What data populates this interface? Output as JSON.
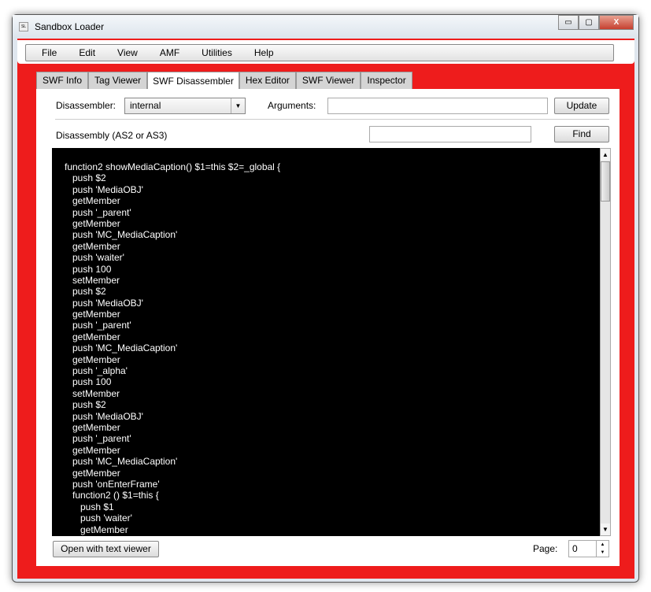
{
  "window": {
    "title": "Sandbox Loader",
    "minimize": "▭",
    "maximize": "▢",
    "close": "X",
    "icon_text": "SL"
  },
  "menu": [
    "File",
    "Edit",
    "View",
    "AMF",
    "Utilities",
    "Help"
  ],
  "tabs": [
    {
      "label": "SWF Info"
    },
    {
      "label": "Tag Viewer"
    },
    {
      "label": "SWF Disassembler",
      "active": true
    },
    {
      "label": "Hex Editor"
    },
    {
      "label": "SWF Viewer"
    },
    {
      "label": "Inspector"
    }
  ],
  "toolbar": {
    "disassembler_label": "Disassembler:",
    "disassembler_value": "internal",
    "arguments_label": "Arguments:",
    "arguments_value": "",
    "update": "Update",
    "disassembly_label": "Disassembly (AS2 or AS3)",
    "find_value": "",
    "find": "Find"
  },
  "code": [
    "function2 showMediaCaption() $1=this $2=_global {",
    "   push $2",
    "   push 'MediaOBJ'",
    "   getMember",
    "   push '_parent'",
    "   getMember",
    "   push 'MC_MediaCaption'",
    "   getMember",
    "   push 'waiter'",
    "   push 100",
    "   setMember",
    "   push $2",
    "   push 'MediaOBJ'",
    "   getMember",
    "   push '_parent'",
    "   getMember",
    "   push 'MC_MediaCaption'",
    "   getMember",
    "   push '_alpha'",
    "   push 100",
    "   setMember",
    "   push $2",
    "   push 'MediaOBJ'",
    "   getMember",
    "   push '_parent'",
    "   getMember",
    "   push 'MC_MediaCaption'",
    "   getMember",
    "   push 'onEnterFrame'",
    "   function2 () $1=this {",
    "      push $1",
    "      push 'waiter'",
    "      getMember"
  ],
  "footer": {
    "open_text_viewer": "Open with text viewer",
    "page_label": "Page:",
    "page_value": "0"
  }
}
